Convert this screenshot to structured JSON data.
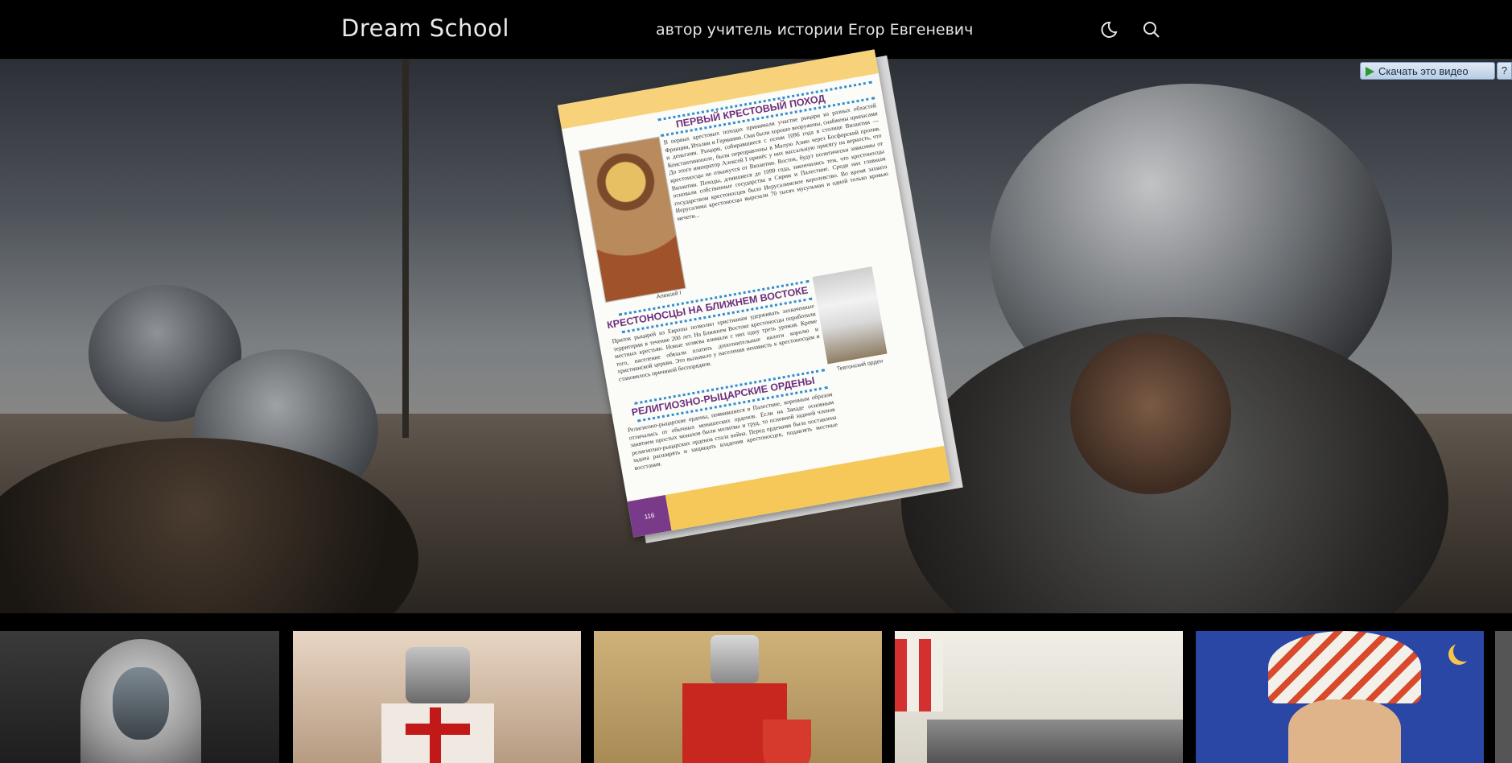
{
  "header": {
    "brand": "Dream School",
    "author": "автор учитель истории Егор Евгеневич",
    "icons": [
      "moon-icon",
      "search-icon"
    ]
  },
  "video_helper": {
    "download_label": "Скачать это видео",
    "help_label": "?"
  },
  "book_page": {
    "section1_title": "ПЕРВЫЙ КРЕСТОВЫЙ ПОХОД",
    "section1_text": "В первых крестовых походах принимали участие рыцари из разных областей Франции, Италии и Германии. Они были хорошо вооружены, снабжены припасами и деньгами. Рыцари, собиравшиеся с осени 1096 года в столице Византии — Константинополе, были переправлены в Малую Азию через Босфорский пролив. До этого император Алексей I принёс у них вассальную присягу на верность, что крестоносцы не откажутся от Византии. Восток, будут политически зависимы от Византии. Походы, длившиеся до 1099 года, закончились тем, что крестоносцы основали собственные государства в Сирии и Палестине. Среди них главным государством крестоносцев было Иерусалимское королевство. Во время захвата Иерусалима крестоносцы вырезали 70 тысяч мусульман и одной только кровью мечети...",
    "caption_left": "Алексей I",
    "section2_title": "КРЕСТОНОСЦЫ НА БЛИЖНЕМ ВОСТОКЕ",
    "section2_text": "Приток рыцарей из Европы позволил христианам удерживать захваченные территории в течение 200 лет. На Ближнем Востоке крестоносцы поработили местных крестьян. Новые хозяева взимали с них одну треть урожая. Кроме того, население обязали платить дополнительные налоги королю и христианской церкви. Это вызывало у населения ненависть к крестоносцам и становилось причиной беспорядков.",
    "caption_right": "Тевтонский орден",
    "section3_title": "РЕЛИГИОЗНО-РЫЦАРСКИЕ ОРДЕНЫ",
    "section3_text": "Религиозно-рыцарские ордены, появившиеся в Палестине, коренным образом отличались от обычных монашеских орденов. Если на Западе основным занятием простых монахов были молитвы и труд, то основной задачей членов религиозно-рыцарских орденов стала война. Перед орденами была поставлена задача расширять и защищать владения крестоносцев, подавлять местные восстания.",
    "page_number": "116"
  },
  "thumbnails": [
    {
      "name": "thumb-veiled-king"
    },
    {
      "name": "thumb-crusader-knights"
    },
    {
      "name": "thumb-hospitaller-knight"
    },
    {
      "name": "thumb-crusader-army"
    },
    {
      "name": "thumb-saracen-warrior"
    },
    {
      "name": "thumb-partial"
    }
  ]
}
